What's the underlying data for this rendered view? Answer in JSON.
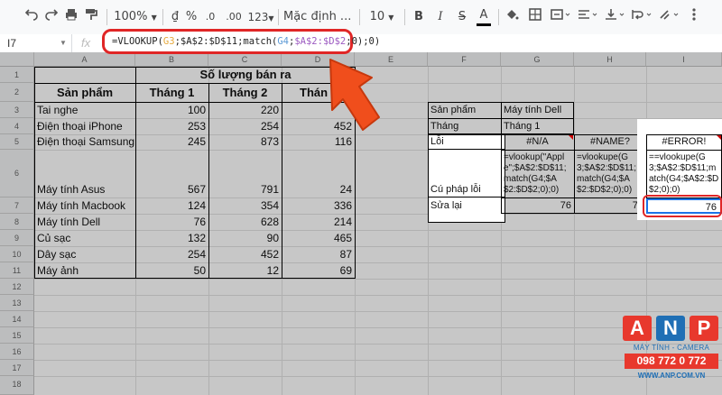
{
  "toolbar": {
    "undo_icon": "undo-icon",
    "redo_icon": "redo-icon",
    "zoom": "100%",
    "currency": "₫",
    "percent": "%",
    "dec_less": ".0",
    "dec_more": ".00",
    "format_more": "123",
    "font": "Mặc định ...",
    "font_size": "10",
    "bold": "B",
    "italic": "I",
    "strike": "S",
    "text_color": "A"
  },
  "formula_bar": {
    "cell_ref": "I7",
    "fx": "fx",
    "formula_parts": [
      "=VLOOKUP(",
      "G3",
      ";$A$2:$D$11;match(",
      "G4",
      ";",
      "$A$2:$D$2",
      ";0);0)"
    ]
  },
  "columns": [
    "A",
    "B",
    "C",
    "D",
    "E",
    "F",
    "G",
    "H",
    "I"
  ],
  "rows": [
    "1",
    "2",
    "3",
    "4",
    "5",
    "6",
    "7",
    "8",
    "9",
    "10",
    "11",
    "12",
    "13",
    "14",
    "15",
    "16",
    "17",
    "18"
  ],
  "table": {
    "merged_title": "Số lượng bán ra",
    "header": [
      "Sản phẩm",
      "Tháng 1",
      "Tháng 2",
      "Thán"
    ],
    "rows": [
      [
        "Tai nghe",
        "100",
        "220",
        ""
      ],
      [
        "Điện thoại iPhone",
        "253",
        "254",
        "452"
      ],
      [
        "Điện thoại Samsung",
        "245",
        "873",
        "116"
      ],
      [
        "Máy tính Asus",
        "567",
        "791",
        "24"
      ],
      [
        "Máy tính Macbook",
        "124",
        "354",
        "336"
      ],
      [
        "Máy tính Dell",
        "76",
        "628",
        "214"
      ],
      [
        "Củ sạc",
        "132",
        "90",
        "465"
      ],
      [
        "Dây sạc",
        "254",
        "452",
        "87"
      ],
      [
        "Máy ảnh",
        "50",
        "12",
        "69"
      ]
    ]
  },
  "lookup": {
    "f3": "Sản phẩm",
    "g3": "Máy tính Dell",
    "f4": "Tháng",
    "g4": "Tháng 1",
    "f5": "Lỗi",
    "g5": "#N/A",
    "h5": "#NAME?",
    "i5": "#ERROR!",
    "f6": "Cú pháp lỗi",
    "g6": "=vlookup(\"Apple\";$A$2:$D$11;match(G4;$A$2:$D$2;0);0)",
    "h6": "=vlookupe(G3;$A$2:$D$11;match(G4;$A$2:$D$2;0);0)",
    "i6": "==vlookupe(G3;$A$2:$D$11;match(G4;$A$2:$D$2;0);0)",
    "f7": "Sửa lại",
    "g7": "76",
    "h7": "76",
    "i7": "76"
  },
  "logo": {
    "letters": [
      "A",
      "N",
      "P"
    ],
    "tagline": "MÁY TÍNH - CAMERA",
    "phone": "098 772 0 772",
    "website": "WWW.ANP.COM.VN",
    "brand_color": "#e8382d",
    "blue_color": "#1f6fb5"
  },
  "colors": {
    "highlight_red": "#e02626",
    "arrow_orange": "#f04e1c",
    "selection_blue": "#1a73e8"
  }
}
